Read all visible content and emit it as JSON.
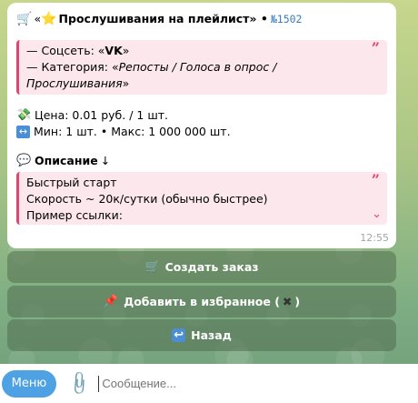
{
  "message": {
    "title_prefix": "«",
    "title": "Прослушивания на плейлист",
    "title_suffix": "» •",
    "order_number": "№1502",
    "social_prefix": "— Соцсеть: «",
    "social_value": "VK",
    "social_suffix": "»",
    "category_prefix": "— Категория: «",
    "category_value": "Репосты / Голоса в опрос / Прослушивания",
    "category_suffix": "»",
    "price_text": "Цена: 0.01 руб. / 1 шт.",
    "minmax_text": "Мин: 1 шт. • Макс: 1 000 000 шт.",
    "description_heading": "Описание",
    "description_arrow": "↓",
    "description_lines": [
      "Быстрый старт",
      "Скорость ~ 20к/сутки (обычно быстрее)",
      "Пример ссылки:"
    ],
    "time": "12:55"
  },
  "icons": {
    "cart": "shopping-cart-icon",
    "star": "star-icon",
    "money": "money-icon",
    "arrows": "left-right-arrow-icon",
    "speech": "speech-bubble-icon",
    "pin": "pushpin-icon",
    "cross": "cross-mark-icon",
    "back": "back-arrow-icon"
  },
  "keyboard": {
    "create_order": "Создать заказ",
    "add_favorite_prefix": "Добавить в избранное (",
    "add_favorite_suffix": ")",
    "back": "Назад"
  },
  "composer": {
    "menu_label": "Меню",
    "placeholder": "Сообщение..."
  },
  "colors": {
    "quote_accent": "#e0456e",
    "order_number": "#3a7bbf",
    "menu_button": "#4ea1e2"
  }
}
